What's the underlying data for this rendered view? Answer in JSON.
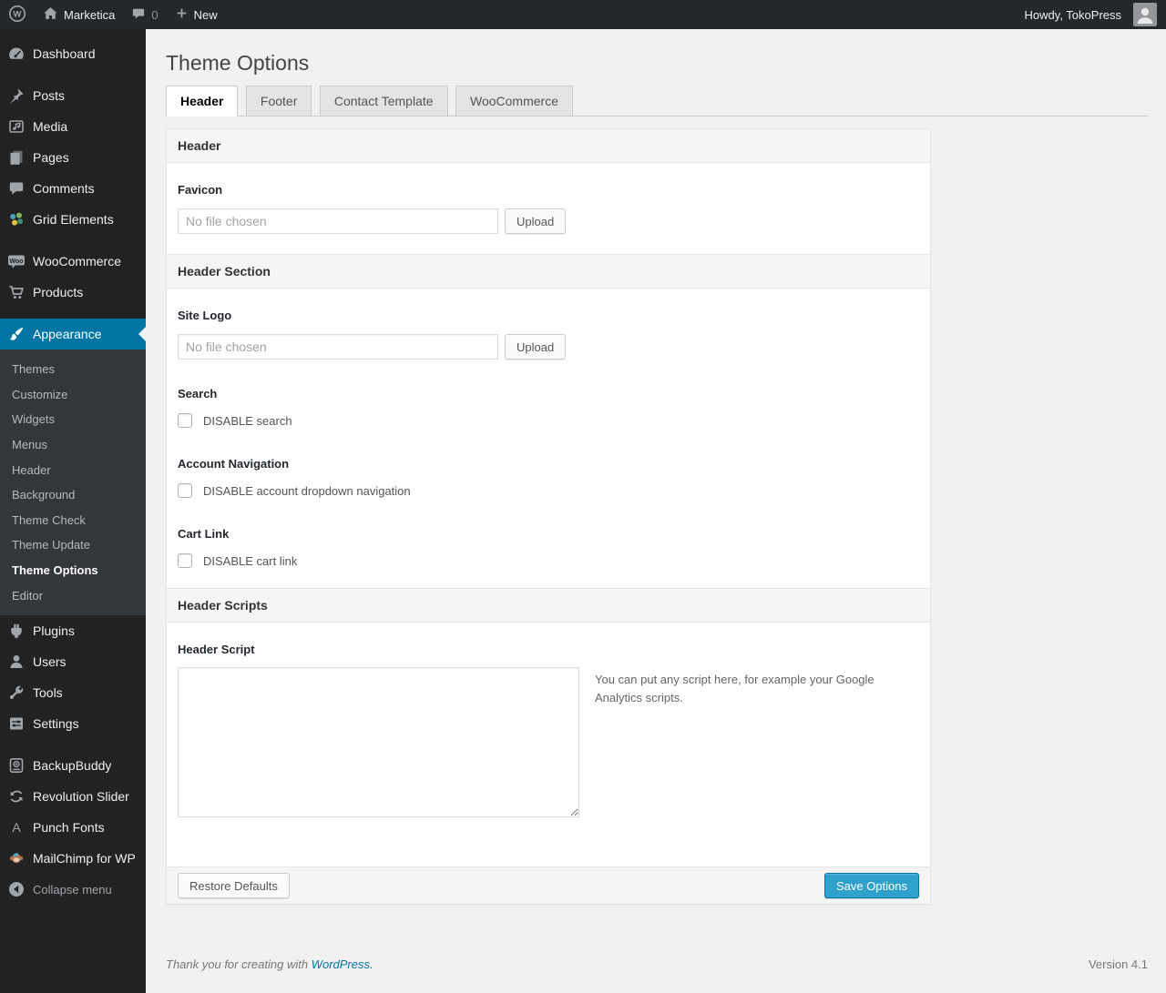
{
  "admin_bar": {
    "site_name": "Marketica",
    "comments_count": "0",
    "new_label": "New",
    "howdy_text": "Howdy, TokoPress"
  },
  "sidebar": {
    "menu": [
      {
        "label": "Dashboard"
      },
      {
        "label": "Posts"
      },
      {
        "label": "Media"
      },
      {
        "label": "Pages"
      },
      {
        "label": "Comments"
      },
      {
        "label": "Grid Elements"
      },
      {
        "label": "WooCommerce"
      },
      {
        "label": "Products"
      },
      {
        "label": "Appearance"
      },
      {
        "label": "Plugins"
      },
      {
        "label": "Users"
      },
      {
        "label": "Tools"
      },
      {
        "label": "Settings"
      },
      {
        "label": "BackupBuddy"
      },
      {
        "label": "Revolution Slider"
      },
      {
        "label": "Punch Fonts"
      },
      {
        "label": "MailChimp for WP"
      }
    ],
    "appearance_submenu": [
      {
        "label": "Themes"
      },
      {
        "label": "Customize"
      },
      {
        "label": "Widgets"
      },
      {
        "label": "Menus"
      },
      {
        "label": "Header"
      },
      {
        "label": "Background"
      },
      {
        "label": "Theme Check"
      },
      {
        "label": "Theme Update"
      },
      {
        "label": "Theme Options",
        "active": true
      },
      {
        "label": "Editor"
      }
    ],
    "active_item": "Appearance",
    "collapse_label": "Collapse menu"
  },
  "icons": {
    "wp_logo_glyph": "W",
    "woo_badge": "Woo",
    "punch_fonts_glyph": "A"
  },
  "page": {
    "title": "Theme Options",
    "tabs": [
      {
        "label": "Header",
        "active": true
      },
      {
        "label": "Footer",
        "active": false
      },
      {
        "label": "Contact Template",
        "active": false
      },
      {
        "label": "WooCommerce",
        "active": false
      }
    ]
  },
  "panel": {
    "header_section_title": "Header",
    "favicon_label": "Favicon",
    "favicon_placeholder": "No file chosen",
    "favicon_upload_label": "Upload",
    "header_area_title": "Header Section",
    "site_logo_label": "Site Logo",
    "site_logo_placeholder": "No file chosen",
    "site_logo_upload_label": "Upload",
    "search_label": "Search",
    "disable_search_label": "DISABLE search",
    "account_nav_label": "Account Navigation",
    "disable_account_label": "DISABLE account dropdown navigation",
    "cart_link_label": "Cart Link",
    "disable_cart_label": "DISABLE cart link",
    "scripts_title": "Header Scripts",
    "header_script_label": "Header Script",
    "header_script_value": "",
    "script_help": "You can put any script here, for example your Google Analytics scripts.",
    "restore_button": "Restore Defaults",
    "save_button": "Save Options"
  },
  "footer": {
    "thanks_text": "Thank you for creating with",
    "wordpress_link": "WordPress.",
    "version": "Version 4.1"
  },
  "colors": {
    "accent": "#0074a2",
    "primary_button": "#2ea2cc",
    "sidebar_bg": "#222222",
    "submenu_bg": "#32373c",
    "admin_bar_bg": "#23282d",
    "page_bg": "#f1f1f1"
  }
}
